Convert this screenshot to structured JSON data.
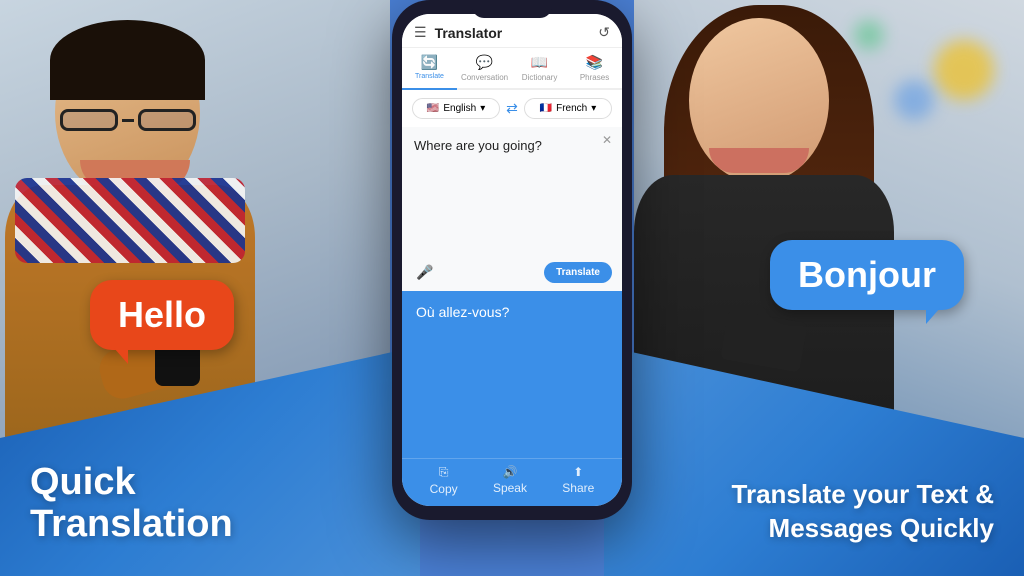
{
  "app": {
    "title": "Translator",
    "header": {
      "menu_icon": "☰",
      "history_icon": "↺",
      "title": "Translator"
    },
    "tabs": [
      {
        "id": "translate",
        "icon": "🔄",
        "label": "Translate",
        "active": true
      },
      {
        "id": "conversation",
        "icon": "💬",
        "label": "Conversation",
        "active": false
      },
      {
        "id": "dictionary",
        "icon": "📖",
        "label": "Dictionary",
        "active": false
      },
      {
        "id": "phrases",
        "icon": "📚",
        "label": "Phrases",
        "active": false
      }
    ],
    "language_from": {
      "flag": "🇺🇸",
      "name": "English",
      "dropdown": "▾"
    },
    "swap_icon": "⇄",
    "language_to": {
      "flag": "🇫🇷",
      "name": "French",
      "dropdown": "▾"
    },
    "input_text": "Where are you going?",
    "close_button": "✕",
    "mic_icon": "🎤",
    "translate_button": "Translate",
    "output_text": "Où allez-vous?",
    "action_bar": [
      {
        "icon": "⎘",
        "label": "Copy"
      },
      {
        "icon": "🔊",
        "label": "Speak"
      },
      {
        "icon": "⬆",
        "label": "Share"
      }
    ]
  },
  "left_bubble": {
    "text": "Hello"
  },
  "right_bubble": {
    "text": "Bonjour"
  },
  "left_caption": {
    "line1": "Quick",
    "line2": "Translation"
  },
  "right_caption": {
    "line1": "Translate your Text &",
    "line2": "Messages Quickly"
  },
  "colors": {
    "blue_primary": "#3b8fe8",
    "orange_bubble": "#e8471a",
    "blue_bubble": "#3b8fe8",
    "dark_phone": "#1a1a2e",
    "overlay_blue": "#1a5fb4"
  }
}
